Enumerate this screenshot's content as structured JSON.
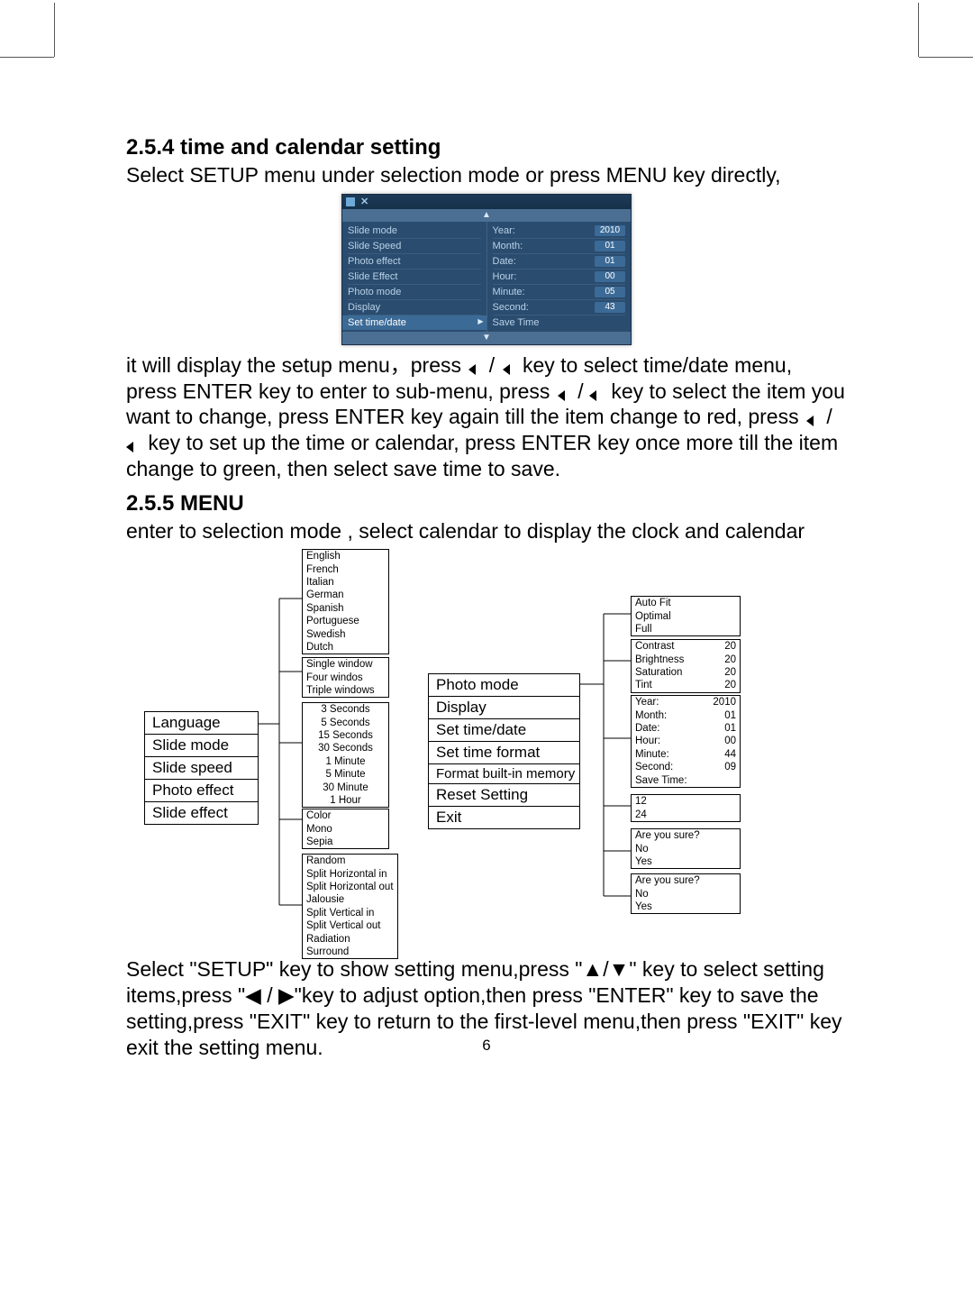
{
  "page_number": "6",
  "sections": {
    "s254": {
      "heading": "2.5.4 time and calendar setting",
      "p1": "Select SETUP menu under selection mode or press MENU key directly,",
      "p2a": "it will display the setup menu，press",
      "p2b": "key to select time/date menu, press ENTER key to enter to sub-menu, press",
      "p2c": "key to select the item you want to change, press ENTER key again till the item change to red, press",
      "p2d": "key to set up the time or calendar, press ENTER key once more till the item change to green, then select save time to save."
    },
    "s255": {
      "heading": "2.5.5 MENU",
      "p1": "enter to selection mode , select calendar to display the clock and calendar",
      "p2": "Select \"SETUP\" key to show setting menu,press \"▲/▼\" key to select setting items,press \"◀ / ▶\"key to adjust option,then press \"ENTER\" key to save the setting,press \"EXIT\" key to return to the first-level menu,then press \"EXIT\" key exit the setting menu."
    }
  },
  "device_shot": {
    "left_items": [
      "Slide mode",
      "Slide Speed",
      "Photo effect",
      "Slide Effect",
      "Photo mode",
      "Display",
      "Set time/date"
    ],
    "right_rows": [
      {
        "label": "Year:",
        "value": "2010"
      },
      {
        "label": "Month:",
        "value": "01"
      },
      {
        "label": "Date:",
        "value": "01"
      },
      {
        "label": "Hour:",
        "value": "00"
      },
      {
        "label": "Minute:",
        "value": "05"
      },
      {
        "label": "Second:",
        "value": "43"
      },
      {
        "label": "Save Time",
        "value": ""
      }
    ],
    "arrow_up": "▲",
    "arrow_down": "▼"
  },
  "tree": {
    "main1": [
      "Language",
      "Slide mode",
      "Slide speed",
      "Photo effect",
      "Slide effect"
    ],
    "languages": [
      "English",
      "French",
      "Italian",
      "German",
      "Spanish",
      "Portuguese",
      "Swedish",
      "Dutch"
    ],
    "slide_modes": [
      "Single window",
      "Four windos",
      "Triple windows"
    ],
    "slide_speeds": [
      "3 Seconds",
      "5 Seconds",
      "15 Seconds",
      "30 Seconds",
      "1 Minute",
      "5 Minute",
      "30 Minute",
      "1 Hour"
    ],
    "photo_effects": [
      "Color",
      "Mono",
      "Sepia"
    ],
    "slide_effects": [
      "Random",
      "Split Horizontal in",
      "Split Horizontal out",
      "Jalousie",
      "Split Vertical in",
      "Split Vertical out",
      "Radiation",
      "Surround"
    ],
    "main2": [
      "Photo mode",
      "Display",
      "Set time/date",
      "Set time format",
      "Format built-in memory",
      "Reset Setting",
      "Exit"
    ],
    "photo_modes": [
      "Auto Fit",
      "Optimal",
      "Full"
    ],
    "display_rows": [
      {
        "k": "Contrast",
        "v": "20"
      },
      {
        "k": "Brightness",
        "v": "20"
      },
      {
        "k": "Saturation",
        "v": "20"
      },
      {
        "k": "Tint",
        "v": "20"
      }
    ],
    "time_rows": [
      {
        "k": "Year:",
        "v": "2010"
      },
      {
        "k": "Month:",
        "v": "01"
      },
      {
        "k": "Date:",
        "v": "01"
      },
      {
        "k": "Hour:",
        "v": "00"
      },
      {
        "k": "Minute:",
        "v": "44"
      },
      {
        "k": "Second:",
        "v": "09"
      },
      {
        "k": "Save Time:",
        "v": ""
      }
    ],
    "time_formats": [
      "12",
      "24"
    ],
    "confirm": [
      "Are you sure?",
      "No",
      "Yes"
    ]
  }
}
